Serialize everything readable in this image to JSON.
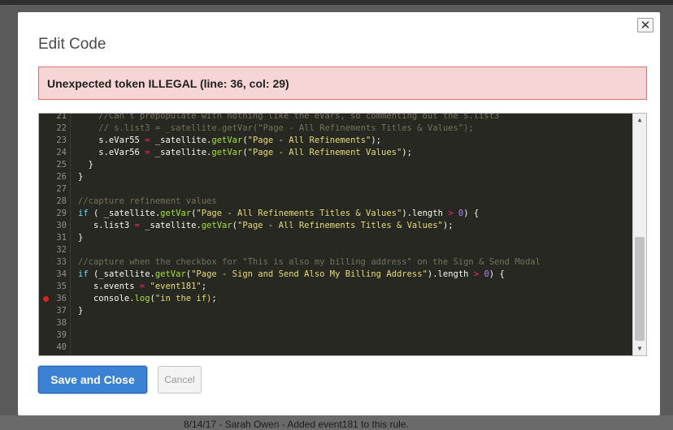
{
  "modal": {
    "title": "Edit Code",
    "close_symbol": "✕",
    "error_message": "Unexpected token ILLEGAL (line: 36, col: 29)",
    "save_label": "Save and Close",
    "cancel_label": "Cancel"
  },
  "editor": {
    "breakpoint_line": 36,
    "scroll_up_symbol": "▲",
    "scroll_down_symbol": "▼",
    "lines": [
      {
        "n": "21",
        "html": "    <span class='c-com'>//Can't prepopulate with nothing like the eVars, so commenting out the s.list3</span>"
      },
      {
        "n": "22",
        "html": "    <span class='c-com'>// s.list3 = _satellite.getVar(\"Page - All Refinements Titles &amp; Values\");</span>"
      },
      {
        "n": "23",
        "html": "    s.eVar55 <span class='c-op'>=</span> _satellite.<span class='c-fn'>getVar</span>(<span class='c-str'>\"Page - All Refinements\"</span>);"
      },
      {
        "n": "24",
        "html": "    s.eVar56 <span class='c-op'>=</span> _satellite.<span class='c-fn'>getVar</span>(<span class='c-str'>\"Page - All Refinement Values\"</span>);"
      },
      {
        "n": "25",
        "html": "  }"
      },
      {
        "n": "26",
        "html": "}"
      },
      {
        "n": "27",
        "html": ""
      },
      {
        "n": "28",
        "html": "<span class='c-com'>//capture refinement values</span>"
      },
      {
        "n": "29",
        "html": "<span class='c-kw'>if</span> ( _satellite.<span class='c-fn'>getVar</span>(<span class='c-str'>\"Page - All Refinements Titles &amp; Values\"</span>).length <span class='c-op'>&gt;</span> <span class='c-num'>0</span>) {"
      },
      {
        "n": "30",
        "html": "   s.list3 <span class='c-op'>=</span> _satellite.<span class='c-fn'>getVar</span>(<span class='c-str'>\"Page - All Refinements Titles &amp; Values\"</span>);"
      },
      {
        "n": "31",
        "html": "}"
      },
      {
        "n": "32",
        "html": ""
      },
      {
        "n": "33",
        "html": "<span class='c-com'>//capture when the checkbox for \"This is also my billing address\" on the Sign &amp; Send Modal</span>"
      },
      {
        "n": "34",
        "html": "<span class='c-kw'>if</span> (_satellite.<span class='c-fn'>getVar</span>(<span class='c-str'>\"Page - Sign and Send Also My Billing Address\"</span>).length <span class='c-op'>&gt;</span> <span class='c-num'>0</span>) {"
      },
      {
        "n": "35",
        "html": "   s.events <span class='c-op'>=</span> <span class='c-str'>\"event181\"</span>;"
      },
      {
        "n": "36",
        "html": "   console.<span class='c-fn'>log</span>(<span class='c-str'>\"in the if)</span>;"
      },
      {
        "n": "37",
        "html": "}"
      },
      {
        "n": "38",
        "html": ""
      },
      {
        "n": "39",
        "html": ""
      },
      {
        "n": "40",
        "html": ""
      }
    ]
  },
  "background": {
    "footer_note": "8/14/17 - Sarah Owen - Added event181 to this rule."
  }
}
